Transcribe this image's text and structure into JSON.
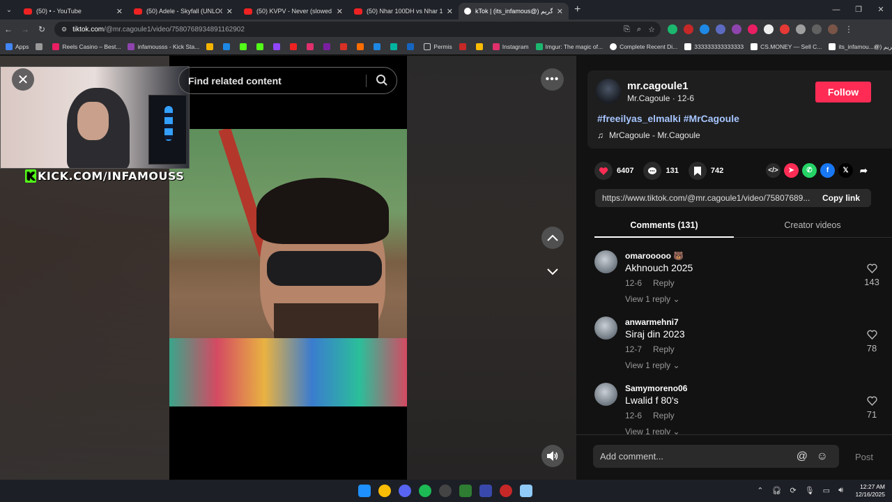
{
  "browser": {
    "tabs": [
      {
        "title": "(50) • - YouTube",
        "active": false
      },
      {
        "title": "(50) Adele - Skyfall (UNLOGIX R",
        "active": false
      },
      {
        "title": "(50) KVPV - Never (slowed + re",
        "active": false
      },
      {
        "title": "(50) Nhar 100DH vs Nhar 10 00",
        "active": false
      },
      {
        "title": "kTok | (its_infamous@) گريم",
        "active": true
      }
    ],
    "new_tab": "+",
    "url_host": "tiktok.com",
    "url_path": "/@mr.cagoule1/video/7580768934891162902",
    "bookmarks": [
      "Apps",
      "Reels Casino – Best...",
      "infamousss - Kick Sta...",
      "Permis",
      "Instagram",
      "Imgur: The magic of...",
      "Complete Recent Di...",
      "333333333333333",
      "CS.MONEY — Sell C...",
      "its_infamou...@) گريم"
    ],
    "bookmark_colors": [
      "#4285f4",
      "#e91e63",
      "#8e44ad",
      "#f5b400",
      "#999999",
      "#e1306c",
      "#1bb76e",
      "#ffffff",
      "#ffffff",
      "#ffffff",
      "#ffffff"
    ]
  },
  "player": {
    "search_placeholder": "Find related content",
    "overlay_text": "KICK.COM/INFAMOUSS"
  },
  "post": {
    "username": "mr.cagoule1",
    "display_name": "Mr.Cagoule",
    "date": "12-6",
    "follow_label": "Follow",
    "hashtags": "#freeilyas_elmalki #MrCagoule",
    "music": "MrCagoule - Mr.Cagoule",
    "likes": "6407",
    "comments": "131",
    "saves": "742",
    "link": "https://www.tiktok.com/@mr.cagoule1/video/75807689...",
    "copy_link_label": "Copy link",
    "accent_color": "#fe2c55"
  },
  "tabs": {
    "comments": "Comments (131)",
    "creator": "Creator videos"
  },
  "comments": [
    {
      "user": "omarooooo 🐻",
      "text": "Akhnouch 2025",
      "date": "12-6",
      "reply": "Reply",
      "view": "View 1 reply ⌄",
      "likes": "143"
    },
    {
      "user": "anwarmehni7",
      "text": "Siraj din 2023",
      "date": "12-7",
      "reply": "Reply",
      "view": "View 1 reply ⌄",
      "likes": "78"
    },
    {
      "user": "Samymoreno06",
      "text": "Lwalid f 80's",
      "date": "12-6",
      "reply": "Reply",
      "view": "View 1 reply ⌄",
      "likes": "71"
    }
  ],
  "compose": {
    "placeholder": "Add comment...",
    "post_label": "Post"
  },
  "taskbar": {
    "time": "12:27 AM",
    "date": "12/16/2025"
  }
}
